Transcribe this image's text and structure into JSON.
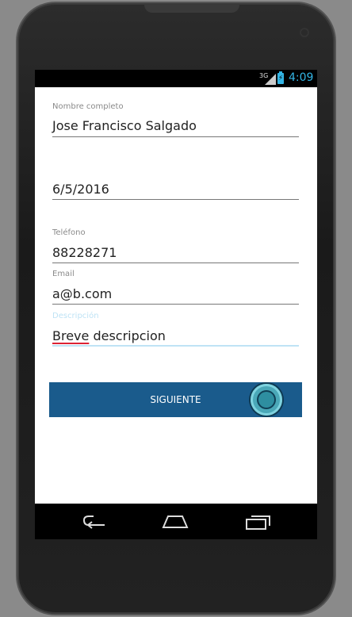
{
  "status_bar": {
    "network": "3G",
    "time": "4:09"
  },
  "form": {
    "fields": [
      {
        "label": "Nombre completo",
        "value": "Jose Francisco Salgado"
      },
      {
        "label": "",
        "value": "6/5/2016"
      },
      {
        "label": "Teléfono",
        "value": "88228271"
      },
      {
        "label": "Email",
        "value": "a@b.com"
      },
      {
        "label": "Descripción",
        "value_word1": "Breve",
        "value_rest": " descripcion"
      }
    ],
    "next_button_label": "SIGUIENTE"
  },
  "icons": {
    "signal": "signal-icon",
    "battery": "battery-charging-icon",
    "back": "back-icon",
    "home": "home-icon",
    "recents": "recents-icon"
  },
  "colors": {
    "accent": "#33b5e5",
    "button": "#1a5b8c"
  }
}
